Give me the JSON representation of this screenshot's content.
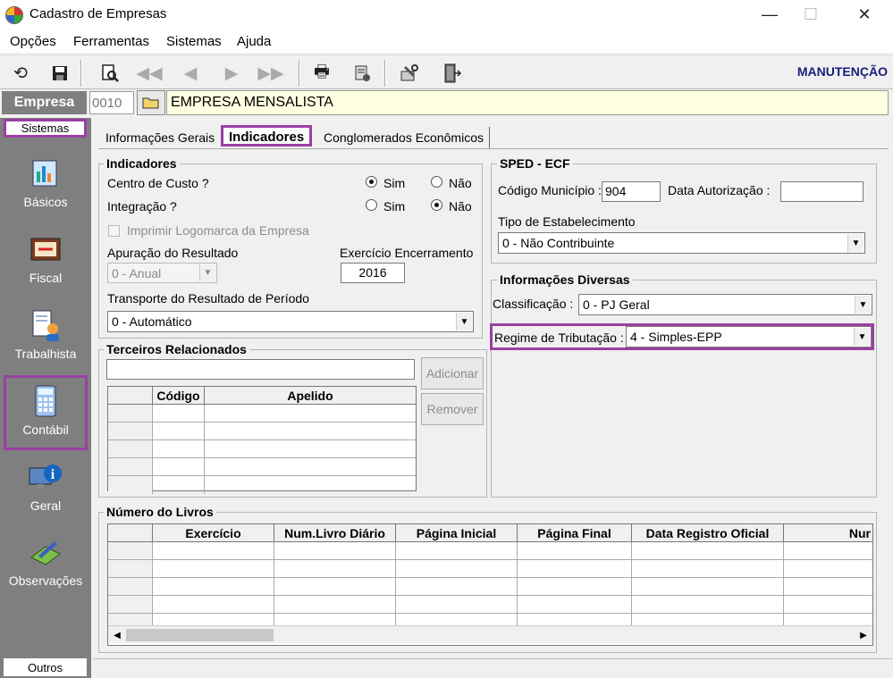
{
  "window": {
    "title": "Cadastro de Empresas",
    "minimize": "—",
    "maximize": "☐",
    "close": "✕"
  },
  "menu": [
    "Opções",
    "Ferramentas",
    "Sistemas",
    "Ajuda"
  ],
  "toolbar": {
    "mode_label": "MANUTENÇÃO"
  },
  "empresa": {
    "label": "Empresa",
    "code": "0010",
    "name": "EMPRESA MENSALISTA"
  },
  "sidebar": {
    "header": "Sistemas",
    "footer": "Outros",
    "items": [
      {
        "label": "Básicos"
      },
      {
        "label": "Fiscal"
      },
      {
        "label": "Trabalhista"
      },
      {
        "label": "Contábil"
      },
      {
        "label": "Geral"
      },
      {
        "label": "Observações"
      }
    ]
  },
  "tabs": [
    "Informações Gerais",
    "Indicadores",
    "Conglomerados Econômicos"
  ],
  "indicadores": {
    "title": "Indicadores",
    "centro_custo": {
      "label": "Centro de Custo ?",
      "sim": "Sim",
      "nao": "Não",
      "selected": "Sim"
    },
    "integracao": {
      "label": "Integração ?",
      "sim": "Sim",
      "nao": "Não",
      "selected": "Não"
    },
    "imprimir_logo": "Imprimir Logomarca da Empresa",
    "apuracao_label": "Apuração do Resultado",
    "apuracao_value": "0 - Anual",
    "exercicio_label": "Exercício Encerramento",
    "exercicio_value": "2016",
    "transporte_label": "Transporte do Resultado de Período",
    "transporte_value": "0 - Automático"
  },
  "sped": {
    "title": "SPED - ECF",
    "codigo_municipio_label": "Código Município :",
    "codigo_municipio_value": "904",
    "data_autorizacao_label": "Data Autorização :",
    "data_autorizacao_value": "",
    "tipo_estab_label": "Tipo de Estabelecimento",
    "tipo_estab_value": "0 - Não Contribuinte"
  },
  "diversas": {
    "title": "Informações Diversas",
    "classificacao_label": "Classificação :",
    "classificacao_value": "0 - PJ Geral",
    "regime_label": "Regime de Tributação :",
    "regime_value": "4 - Simples-EPP"
  },
  "terceiros": {
    "title": "Terceiros Relacionados",
    "input_value": "",
    "add_label": "Adicionar",
    "remove_label": "Remover",
    "columns": [
      "Código",
      "Apelido"
    ]
  },
  "livros": {
    "title": "Número do Livros",
    "columns": [
      "Exercício",
      "Num.Livro Diário",
      "Página Inicial",
      "Página Final",
      "Data Registro Oficial",
      "Nur"
    ]
  },
  "colors": {
    "highlight": "#9b3fa3",
    "sidebar": "#7f7f7f",
    "empresa_name_bg": "#ffffe1",
    "mode_label": "#1b1b7e"
  },
  "icons": [
    "undo-icon",
    "save-icon",
    "preview-icon",
    "first-record-icon",
    "prev-record-icon",
    "next-record-icon",
    "last-record-icon",
    "print-icon",
    "report-icon",
    "tools-icon",
    "exit-icon",
    "folder-icon"
  ]
}
